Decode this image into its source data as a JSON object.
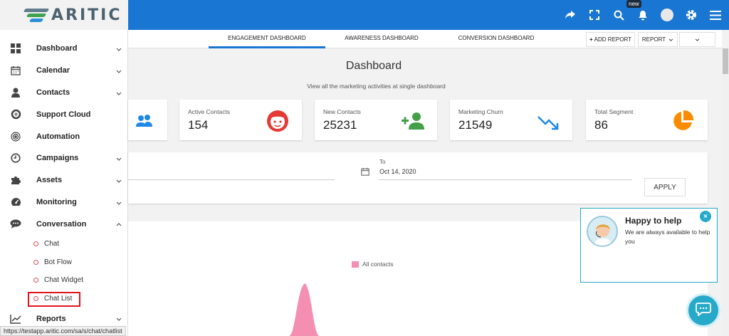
{
  "brand": {
    "name": "ARITIC"
  },
  "topbar": {
    "icons": [
      "share-icon",
      "fullscreen-icon",
      "search-icon",
      "bell-icon",
      "user-avatar",
      "gear-icon",
      "menu-icon"
    ],
    "new_badge": "new",
    "color": "#1976d2"
  },
  "sidebar": {
    "items": [
      {
        "label": "Dashboard",
        "icon": "grid-icon",
        "expanded": false
      },
      {
        "label": "Calendar",
        "icon": "calendar-icon",
        "expanded": false
      },
      {
        "label": "Contacts",
        "icon": "person-icon",
        "expanded": false
      },
      {
        "label": "Support Cloud",
        "icon": "lifebuoy-icon",
        "expanded": false
      },
      {
        "label": "Automation",
        "icon": "target-icon",
        "expanded": false
      },
      {
        "label": "Campaigns",
        "icon": "clock-icon",
        "expanded": false
      },
      {
        "label": "Assets",
        "icon": "puzzle-icon",
        "expanded": false
      },
      {
        "label": "Monitoring",
        "icon": "gauge-icon",
        "expanded": false
      },
      {
        "label": "Conversation",
        "icon": "chat-icon",
        "expanded": true
      }
    ],
    "sub_items": [
      "Chat",
      "Bot Flow",
      "Chat Widget",
      "Chat List"
    ],
    "active_sub_item": "Chat List",
    "last_item": {
      "label": "Reports",
      "icon": "chart-line-icon"
    }
  },
  "status_url": "https://testapp.aritic.com/sa/s/chat/chatlist",
  "tabs": [
    "ENGAGEMENT DASHBOARD",
    "AWARENESS DASHBOARD",
    "CONVERSION DASHBOARD"
  ],
  "active_tab": "ENGAGEMENT DASHBOARD",
  "toolbar": {
    "add_report": "ADD REPORT",
    "report": "REPORT"
  },
  "main": {
    "title": "Dashboard",
    "subtitle": "View all the marketing activities at single dashboard"
  },
  "cards": [
    {
      "label": "Active Contacts",
      "value": "154",
      "icon": "face-icon",
      "color": "#e53935"
    },
    {
      "label": "New Contacts",
      "value": "25231",
      "icon": "add-user-icon",
      "color": "#43a047"
    },
    {
      "label": "Marketing Churn",
      "value": "21549",
      "icon": "trend-down-icon",
      "color": "#1e88e5"
    },
    {
      "label": "Total Segment",
      "value": "86",
      "icon": "pie-icon",
      "color": "#fb8c00"
    }
  ],
  "date_filter": {
    "to_label": "To",
    "to_value": "Oct 14, 2020",
    "apply": "APPLY"
  },
  "chart": {
    "legend": "All contacts",
    "series_color": "#f48fb1"
  },
  "help": {
    "title": "Happy to help",
    "text": "We are always available to help you"
  }
}
